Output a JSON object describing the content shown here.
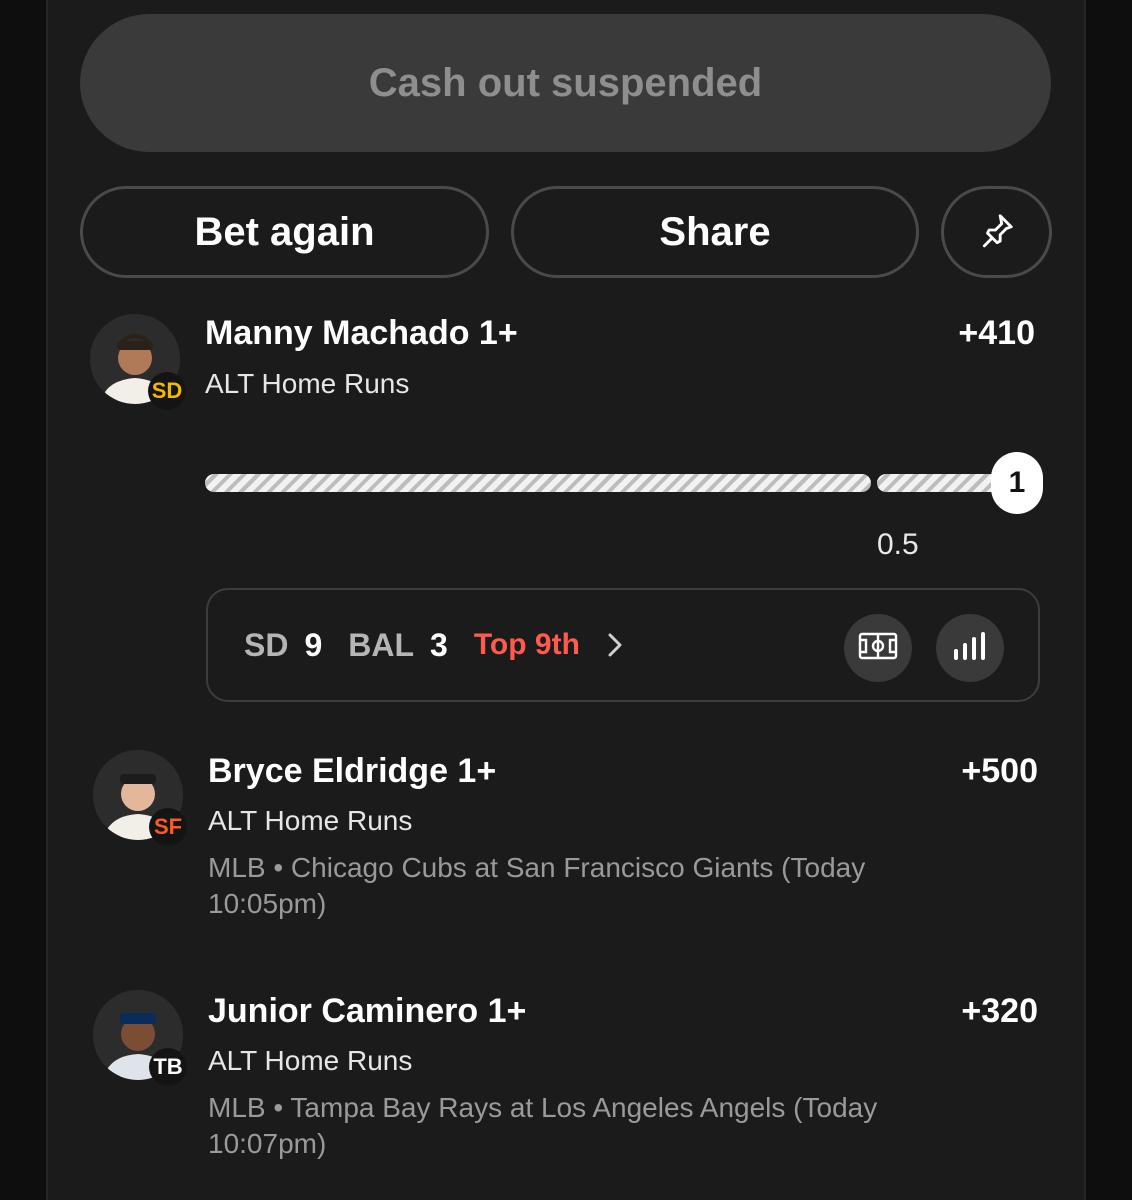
{
  "cashout_label": "Cash out suspended",
  "actions": {
    "bet_again_label": "Bet again",
    "share_label": "Share",
    "pin_icon": "pin-icon"
  },
  "legs": [
    {
      "player": "Manny Machado 1+",
      "odds": "+410",
      "market": "ALT Home Runs",
      "team_logo_text": "SD",
      "team_color": "#f5b800",
      "progress": {
        "current": 0,
        "threshold_label": "0.5",
        "target_label": "1"
      },
      "live_score": {
        "away_team": "SD",
        "away_score": "9",
        "home_team": "BAL",
        "home_score": "3",
        "inning": "Top 9th",
        "field_icon": "ballpark-icon",
        "stats_icon": "bar-chart-icon"
      }
    },
    {
      "player": "Bryce Eldridge 1+",
      "odds": "+500",
      "market": "ALT Home Runs",
      "team_logo_text": "SF",
      "team_color": "#fd5a1e",
      "game_info": "MLB • Chicago Cubs at San Francisco Giants (Today 10:05pm)"
    },
    {
      "player": "Junior Caminero 1+",
      "odds": "+320",
      "market": "ALT Home Runs",
      "team_logo_text": "TB",
      "team_color": "#ffffff",
      "game_info": "MLB • Tampa Bay Rays at Los Angeles Angels (Today 10:07pm)"
    }
  ]
}
